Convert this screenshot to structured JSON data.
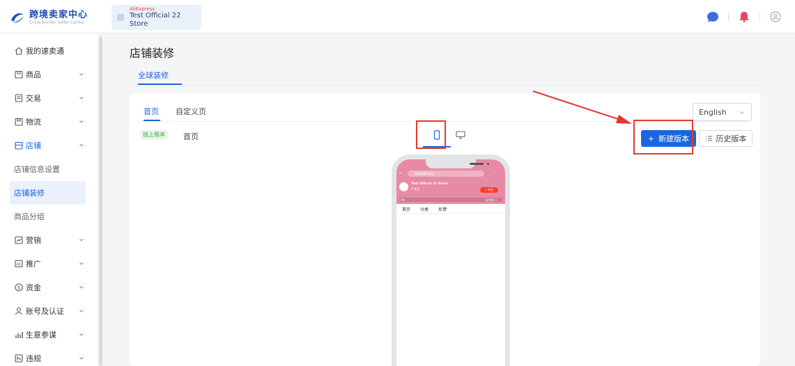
{
  "header": {
    "logo_title": "跨境卖家中心",
    "logo_subtitle": "Cross-border Seller Center",
    "store_brand": "AliExpress",
    "store_name": "Test Official 22 Store",
    "icons": [
      "message-icon",
      "bell-icon",
      "user-icon"
    ]
  },
  "sidebar": {
    "items": [
      {
        "label": "我的速卖通",
        "icon": "home-icon"
      },
      {
        "label": "商品",
        "icon": "product-icon"
      },
      {
        "label": "交易",
        "icon": "trade-icon"
      },
      {
        "label": "物流",
        "icon": "logistics-icon"
      },
      {
        "label": "店铺",
        "icon": "store-icon"
      },
      {
        "label": "店铺信息设置"
      },
      {
        "label": "店铺装修"
      },
      {
        "label": "商品分组"
      },
      {
        "label": "营销",
        "icon": "marketing-icon"
      },
      {
        "label": "推广",
        "icon": "ad-icon"
      },
      {
        "label": "资金",
        "icon": "money-icon"
      },
      {
        "label": "账号及认证",
        "icon": "account-icon"
      },
      {
        "label": "生意参谋",
        "icon": "analytics-icon"
      },
      {
        "label": "违规",
        "icon": "violation-icon"
      }
    ]
  },
  "main": {
    "title": "店铺装修",
    "tab": "全球装修",
    "card_tabs": [
      "首页",
      "自定义页"
    ],
    "language": "English",
    "badge": "线上版本",
    "version_name": "首页",
    "new_version_button": "新建版本",
    "history_button": "历史版本"
  },
  "phone": {
    "search": "搜索店铺内商品",
    "store_name": "Test Official 22 Store",
    "followers": "0 关注",
    "follow_button": "+ 关注",
    "rating_left": "0%",
    "rating_right": "好评率 >",
    "nav": [
      "首页",
      "分类",
      "反馈"
    ]
  },
  "colors": {
    "accent": "#1a66e0",
    "annotation_red": "#e33a2c",
    "phone_header": "#e78aa5"
  }
}
